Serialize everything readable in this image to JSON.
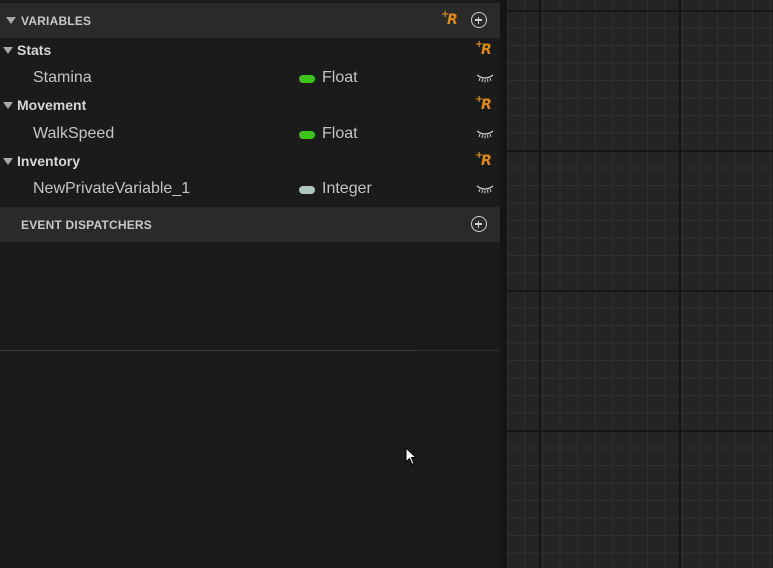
{
  "variables_section": {
    "title": "VARIABLES"
  },
  "categories": [
    {
      "name": "Stats",
      "variables": [
        {
          "name": "Stamina",
          "type": "Float",
          "type_color": "#3ec317"
        }
      ]
    },
    {
      "name": "Movement",
      "variables": [
        {
          "name": "WalkSpeed",
          "type": "Float",
          "type_color": "#3ec317"
        }
      ]
    },
    {
      "name": "Inventory",
      "variables": [
        {
          "name": "NewPrivateVariable_1",
          "type": "Integer",
          "type_color": "#b0c4c0"
        }
      ]
    }
  ],
  "event_dispatchers_section": {
    "title": "EVENT DISPATCHERS"
  },
  "icons": {
    "add_category": "add-category-icon",
    "add_variable": "plus-circle-icon",
    "visibility": "eye-closed-icon",
    "collapse": "caret-down-icon"
  },
  "colors": {
    "accent_orange": "#e08a10",
    "panel_bg": "#1b1b1b",
    "header_bg": "#2a2a2a",
    "graph_bg": "#242424"
  }
}
